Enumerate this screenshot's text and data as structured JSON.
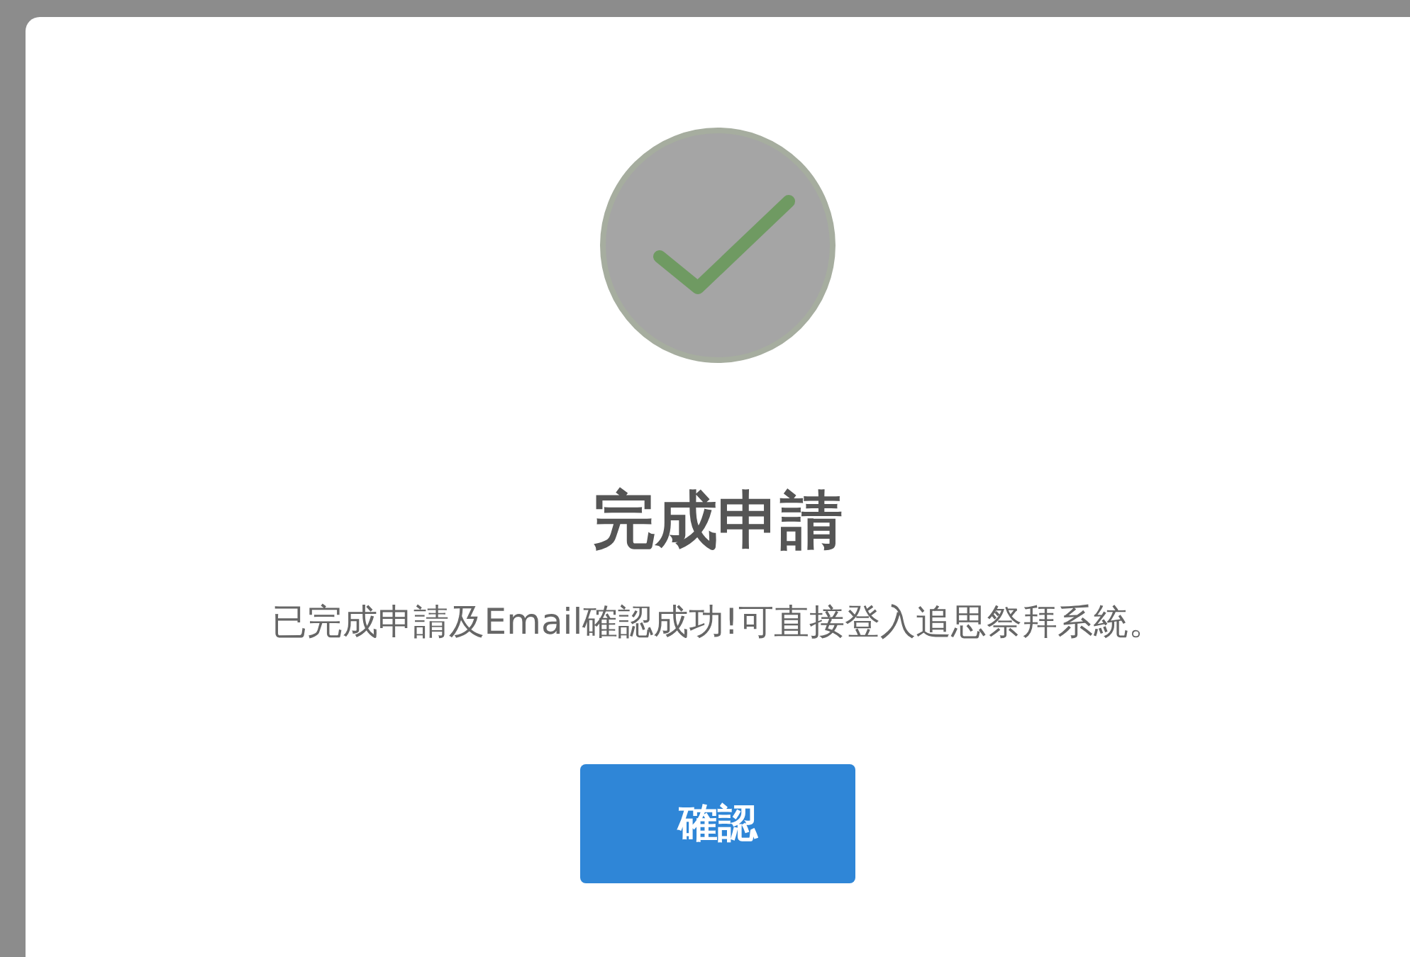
{
  "dialog": {
    "icon": {
      "kind": "success"
    },
    "title": "完成申請",
    "message": "已完成申請及Email確認成功!可直接登入追思祭拜系統。",
    "buttons": [
      {
        "label": "確認"
      }
    ]
  }
}
